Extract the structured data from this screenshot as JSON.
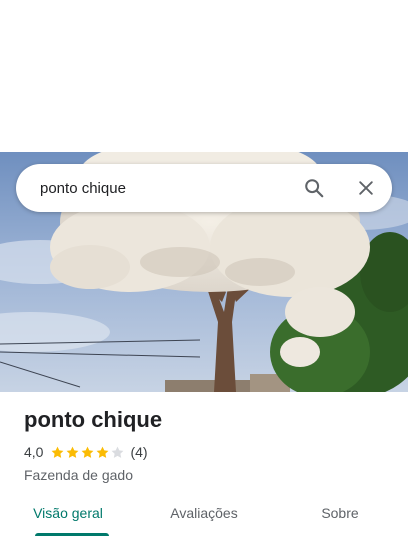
{
  "search": {
    "query": "ponto chique"
  },
  "hero": {
    "icon": "flowering-tree-photo"
  },
  "place": {
    "name": "ponto chique",
    "rating_value": "4,0",
    "rating_stars": 4,
    "rating_max": 5,
    "review_count": "(4)",
    "category": "Fazenda de gado"
  },
  "tabs": [
    {
      "label": "Visão geral",
      "active": true
    },
    {
      "label": "Avaliações",
      "active": false
    },
    {
      "label": "Sobre",
      "active": false
    }
  ],
  "colors": {
    "accent": "#00796b",
    "star_filled": "#fbbc04",
    "star_empty": "#dadce0"
  }
}
